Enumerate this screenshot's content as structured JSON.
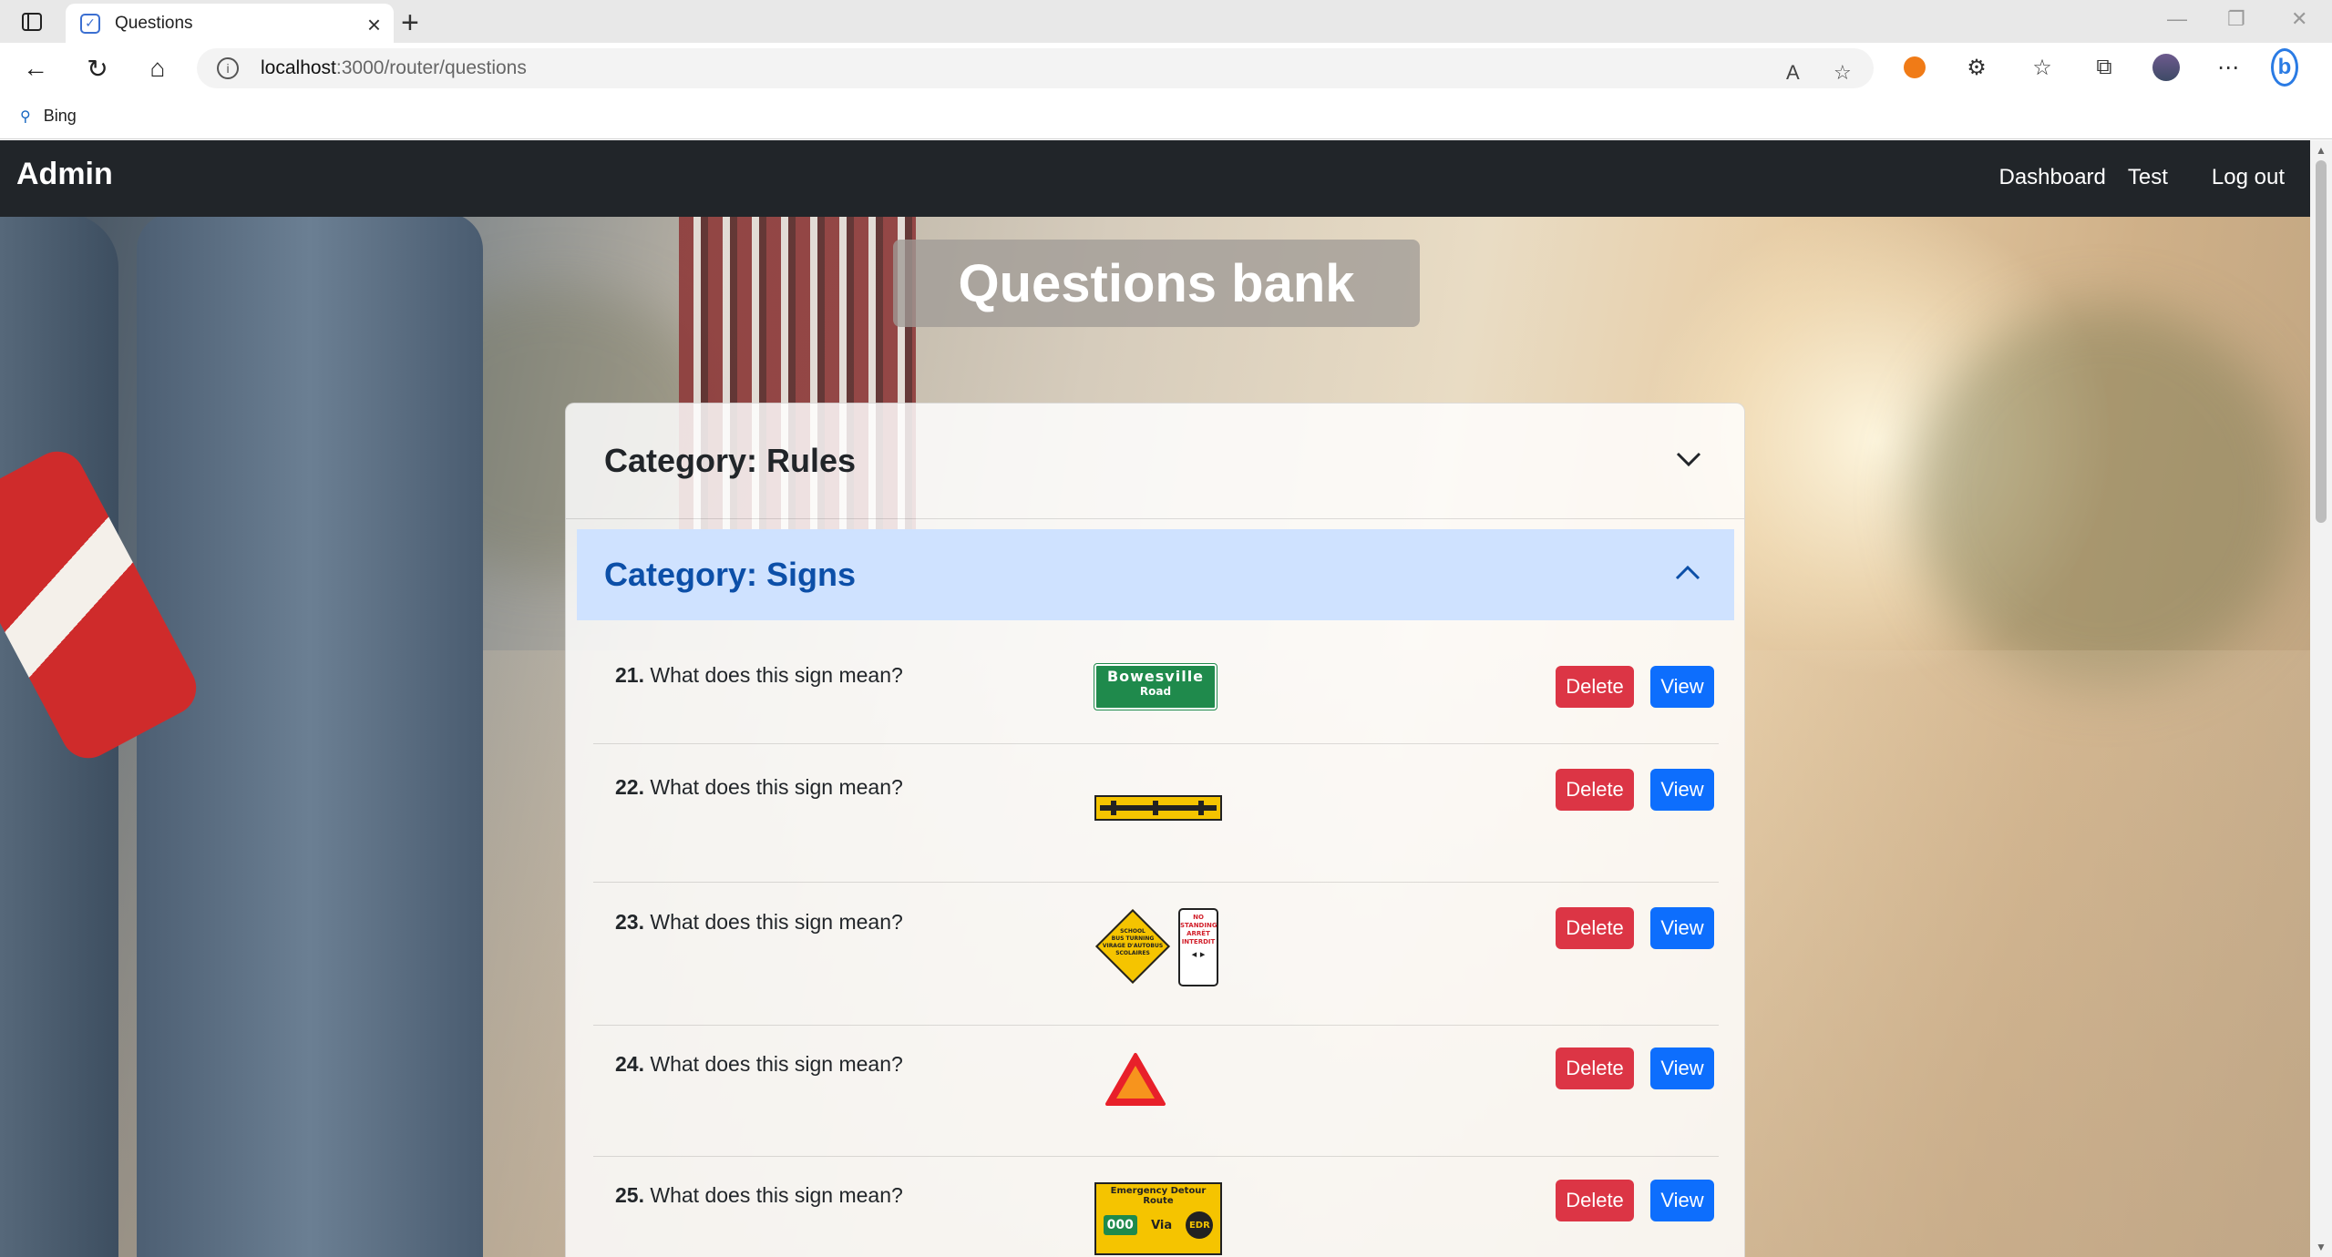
{
  "browser": {
    "tab_title": "Questions",
    "url_host": "localhost",
    "url_path": ":3000/router/questions",
    "favorites": [
      {
        "label": "Bing"
      }
    ]
  },
  "navbar": {
    "brand": "Admin",
    "links": [
      "Dashboard",
      "Test",
      "Log out"
    ]
  },
  "page": {
    "title": "Questions bank"
  },
  "categories": [
    {
      "label": "Category: Rules",
      "expanded": false
    },
    {
      "label": "Category: Signs",
      "expanded": true
    }
  ],
  "questions": [
    {
      "number": "21.",
      "text": "What does this sign mean?",
      "sign": "green-street-sign",
      "sign_text": [
        "Bowesville",
        "Road"
      ]
    },
    {
      "number": "22.",
      "text": "What does this sign mean?",
      "sign": "yellow-bar-sign"
    },
    {
      "number": "23.",
      "text": "What does this sign mean?",
      "sign": "school-bus-and-no-standing-signs",
      "sign_text": [
        "SCHOOL",
        "BUS TURNING",
        "VIRAGE D'AUTOBUS",
        "SCOLAIRES",
        "NO",
        "STANDING",
        "ARRÊT",
        "INTERDIT"
      ]
    },
    {
      "number": "24.",
      "text": "What does this sign mean?",
      "sign": "slow-moving-vehicle-triangle"
    },
    {
      "number": "25.",
      "text": "What does this sign mean?",
      "sign": "emergency-detour-route-sign",
      "sign_text": [
        "Emergency Detour Route",
        "000",
        "Via",
        "EDR"
      ]
    }
  ],
  "buttons": {
    "delete": "Delete",
    "view": "View"
  },
  "colors": {
    "navbar": "#212529",
    "delete": "#dc3545",
    "view": "#0d6efd",
    "active_category_bg": "#cfe2ff",
    "active_category_text": "#0c4fa8"
  }
}
